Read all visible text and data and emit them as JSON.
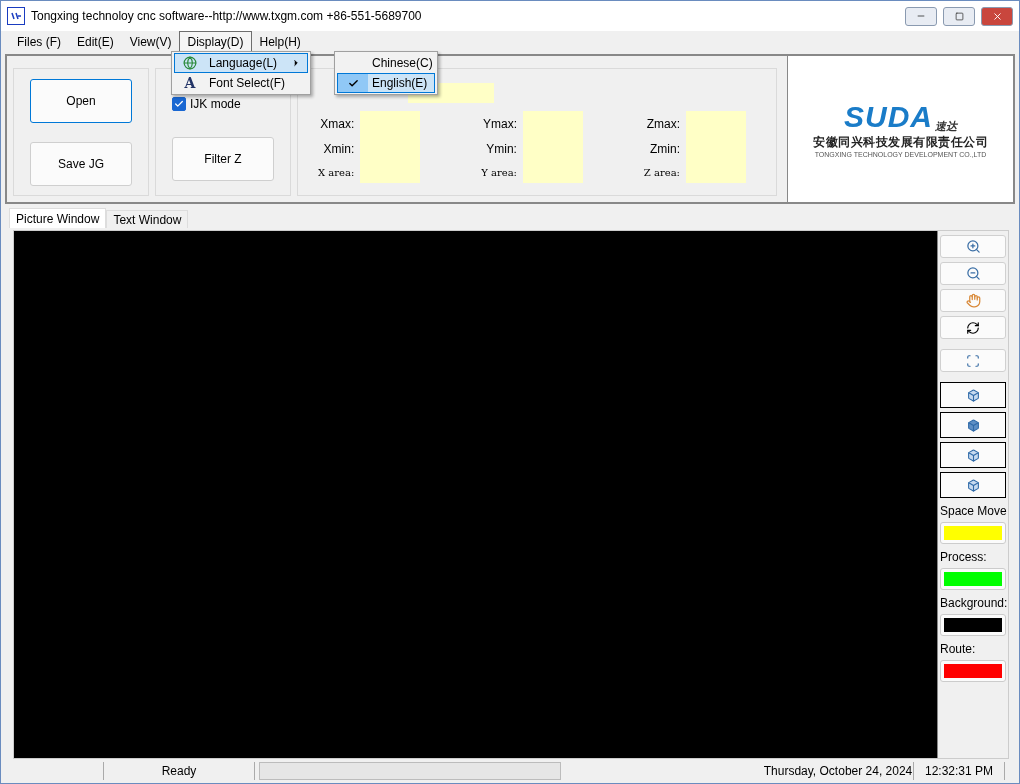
{
  "window": {
    "title": "Tongxing technoloy cnc software--http://www.txgm.com +86-551-5689700"
  },
  "menu": [
    {
      "label": "Files (F)",
      "selected": false
    },
    {
      "label": "Edit(E)",
      "selected": false
    },
    {
      "label": "View(V)",
      "selected": false
    },
    {
      "label": "Display(D)",
      "selected": true
    },
    {
      "label": "Help(H)",
      "selected": false
    }
  ],
  "display_menu": [
    {
      "kind": "language",
      "label": "Language(L)",
      "selected": true
    },
    {
      "kind": "font",
      "glyph": "A",
      "label": "Font Select(F)",
      "selected": false
    }
  ],
  "language_submenu": [
    {
      "label": "Chinese(C)",
      "checked": false,
      "selected": false
    },
    {
      "label": "English(E)",
      "checked": true,
      "selected": true
    }
  ],
  "toolbar": {
    "buttons": [
      "Open",
      "Save JG"
    ],
    "ijk_mode": {
      "label": "IJK mode",
      "checked": true
    },
    "filter_button": "Filter Z",
    "stats": [
      {
        "max_label": "Xmax:",
        "min_label": "Xmin:",
        "area_label": "X area:"
      },
      {
        "max_label": "Ymax:",
        "min_label": "Ymin:",
        "area_label": "Y area:"
      },
      {
        "max_label": "Zmax:",
        "min_label": "Zmin:",
        "area_label": "Z area:"
      }
    ]
  },
  "logo": {
    "brand": "SUDA",
    "brand_cn": "速达",
    "company_cn": "安徽同兴科技发展有限责任公司",
    "company_en": "TONGXING TECHNOLOGY DEVELOPMENT CO.,LTD"
  },
  "tabs": [
    {
      "label": "Picture Window",
      "selected": true
    },
    {
      "label": "Text Window",
      "selected": false
    }
  ],
  "tools": [
    {
      "kind": "zoom-in"
    },
    {
      "kind": "zoom-out"
    },
    {
      "kind": "pan"
    },
    {
      "kind": "rotate"
    },
    {
      "kind": "zoom-fit"
    },
    {
      "kind": "view-iso"
    },
    {
      "kind": "view-front"
    },
    {
      "kind": "view-side"
    },
    {
      "kind": "view-top"
    }
  ],
  "colors": [
    {
      "label": "Space Move",
      "color": "#ffff00"
    },
    {
      "label": "Process:",
      "color": "#00ff00"
    },
    {
      "label": "Background:",
      "color": "#000000"
    },
    {
      "label": "Route:",
      "color": "#ff0000"
    }
  ],
  "status_bar": {
    "status": "Ready",
    "date": "Thursday, October 24, 2024",
    "time": "12:32:31 PM"
  }
}
